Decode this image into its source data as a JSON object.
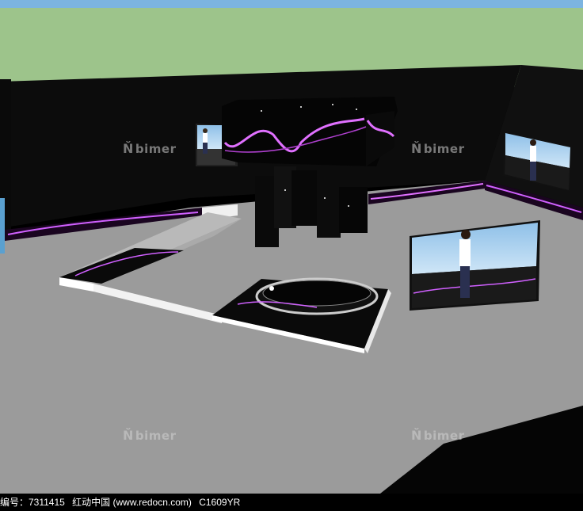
{
  "watermark": {
    "text": "bimer"
  },
  "footer": {
    "id_label": "编号：7311415",
    "site": "红动中国 (www.redocn.com)",
    "code": "C1609YR"
  }
}
